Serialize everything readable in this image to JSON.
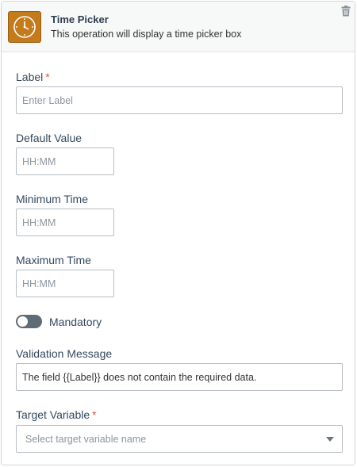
{
  "header": {
    "title": "Time Picker",
    "description": "This operation will display a time picker box",
    "icon": "clock-icon",
    "icon_color": "#c47b1b",
    "delete_icon": "trash-icon"
  },
  "form": {
    "label": {
      "label": "Label",
      "required_marker": "*",
      "placeholder": "Enter Label",
      "value": ""
    },
    "default_value": {
      "label": "Default Value",
      "placeholder": "HH:MM",
      "value": ""
    },
    "minimum_time": {
      "label": "Minimum Time",
      "placeholder": "HH:MM",
      "value": ""
    },
    "maximum_time": {
      "label": "Maximum Time",
      "placeholder": "HH:MM",
      "value": ""
    },
    "mandatory": {
      "label": "Mandatory",
      "checked": false
    },
    "validation_message": {
      "label": "Validation Message",
      "value": "The field {{Label}} does not contain the required data."
    },
    "target_variable": {
      "label": "Target Variable",
      "required_marker": "*",
      "placeholder": "Select target variable name"
    }
  },
  "colors": {
    "required_marker": "#e05a2b",
    "toggle_off": "#5f6b75"
  }
}
